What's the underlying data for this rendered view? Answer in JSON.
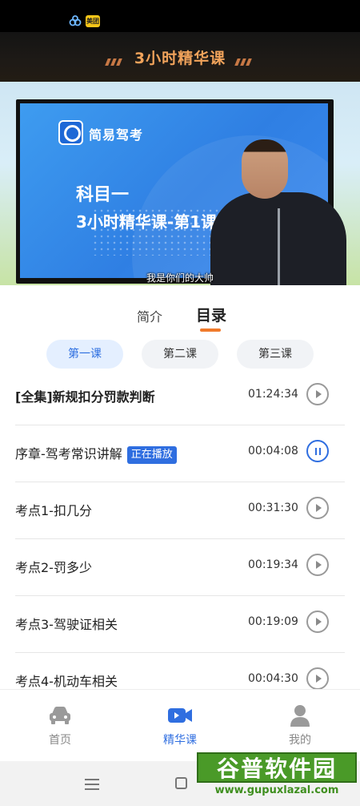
{
  "status_bar": {
    "icons": [
      "baidu-app-icon",
      "meituan-app-icon"
    ],
    "meituan_text": "美团"
  },
  "header": {
    "title": "3小时精华课",
    "accent_color": "#f1a35b"
  },
  "video": {
    "brand": "简易驾考",
    "slide_line1": "科目一",
    "slide_line2": "3小时精华课-第1课",
    "subtitle": "我是你们的大帅"
  },
  "tabs": [
    {
      "label": "简介",
      "active": false
    },
    {
      "label": "目录",
      "active": true
    }
  ],
  "lessons": [
    {
      "label": "第一课",
      "active": true
    },
    {
      "label": "第二课",
      "active": false
    },
    {
      "label": "第三课",
      "active": false
    }
  ],
  "chapters": [
    {
      "title": "[全集]新规扣分罚款判断",
      "duration": "01:24:34",
      "playing": false,
      "bold": true
    },
    {
      "title": "序章-驾考常识讲解",
      "badge": "正在播放",
      "duration": "00:04:08",
      "playing": true
    },
    {
      "title": "考点1-扣几分",
      "duration": "00:31:30",
      "playing": false
    },
    {
      "title": "考点2-罚多少",
      "duration": "00:19:34",
      "playing": false
    },
    {
      "title": "考点3-驾驶证相关",
      "duration": "00:19:09",
      "playing": false
    },
    {
      "title": "考点4-机动车相关",
      "duration": "00:04:30",
      "playing": false
    }
  ],
  "bottom_nav": [
    {
      "label": "首页",
      "icon": "car-icon",
      "active": false
    },
    {
      "label": "精华课",
      "icon": "video-camera-icon",
      "active": true
    },
    {
      "label": "我的",
      "icon": "user-icon",
      "active": false
    }
  ],
  "watermark": {
    "text": "谷普软件园",
    "url": "www.gupuxlazal.com"
  },
  "colors": {
    "primary": "#2f6ee0",
    "tab_underline": "#f07a2a"
  }
}
